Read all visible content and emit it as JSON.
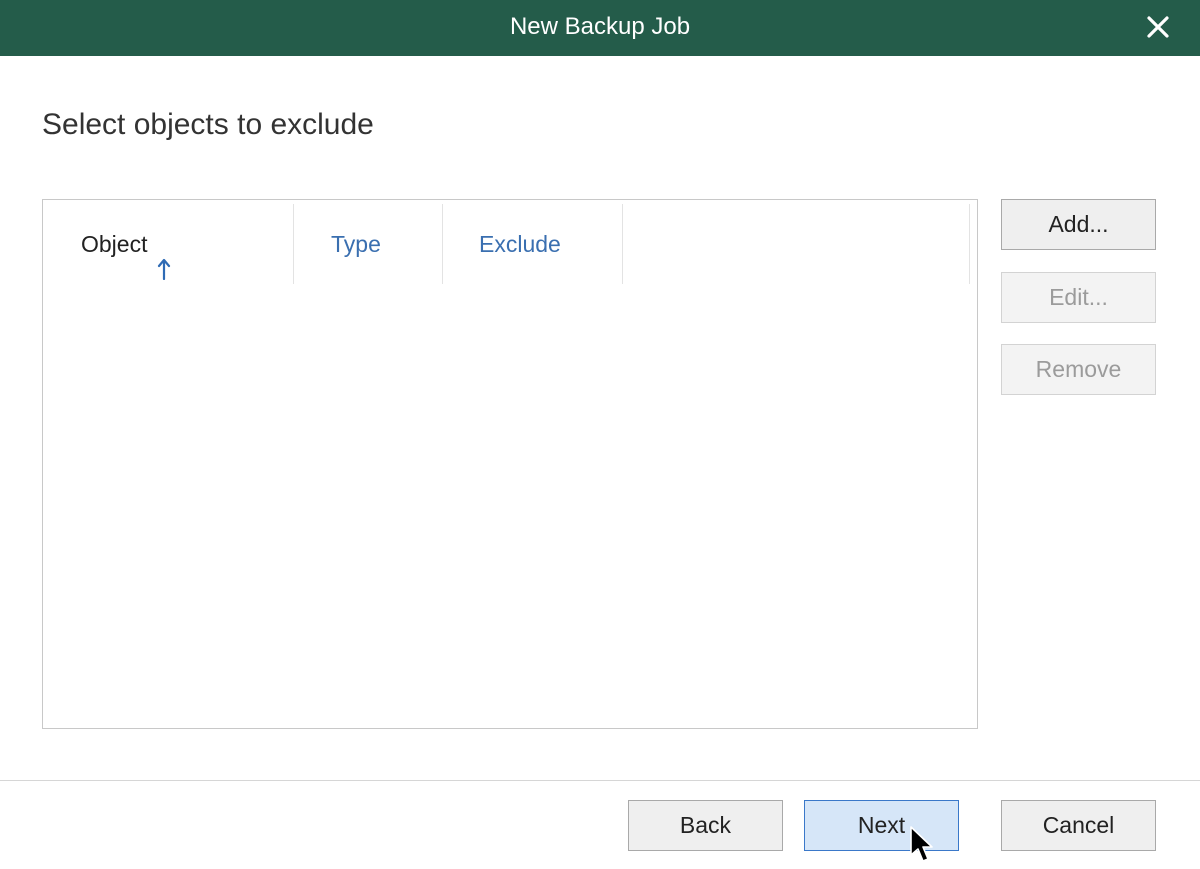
{
  "window": {
    "title": "New Backup Job",
    "close_icon": "close-icon"
  },
  "page": {
    "heading": "Select objects to exclude"
  },
  "table": {
    "columns": [
      {
        "label": "Object",
        "sorted": "ascending"
      },
      {
        "label": "Type"
      },
      {
        "label": "Exclude"
      }
    ],
    "rows": []
  },
  "side_buttons": {
    "add": "Add...",
    "edit": "Edit...",
    "remove": "Remove"
  },
  "footer": {
    "back": "Back",
    "next": "Next",
    "cancel": "Cancel"
  },
  "colors": {
    "titlebar": "#245c4a",
    "link": "#3a6fb0",
    "primary_button": "#d6e6f8"
  }
}
